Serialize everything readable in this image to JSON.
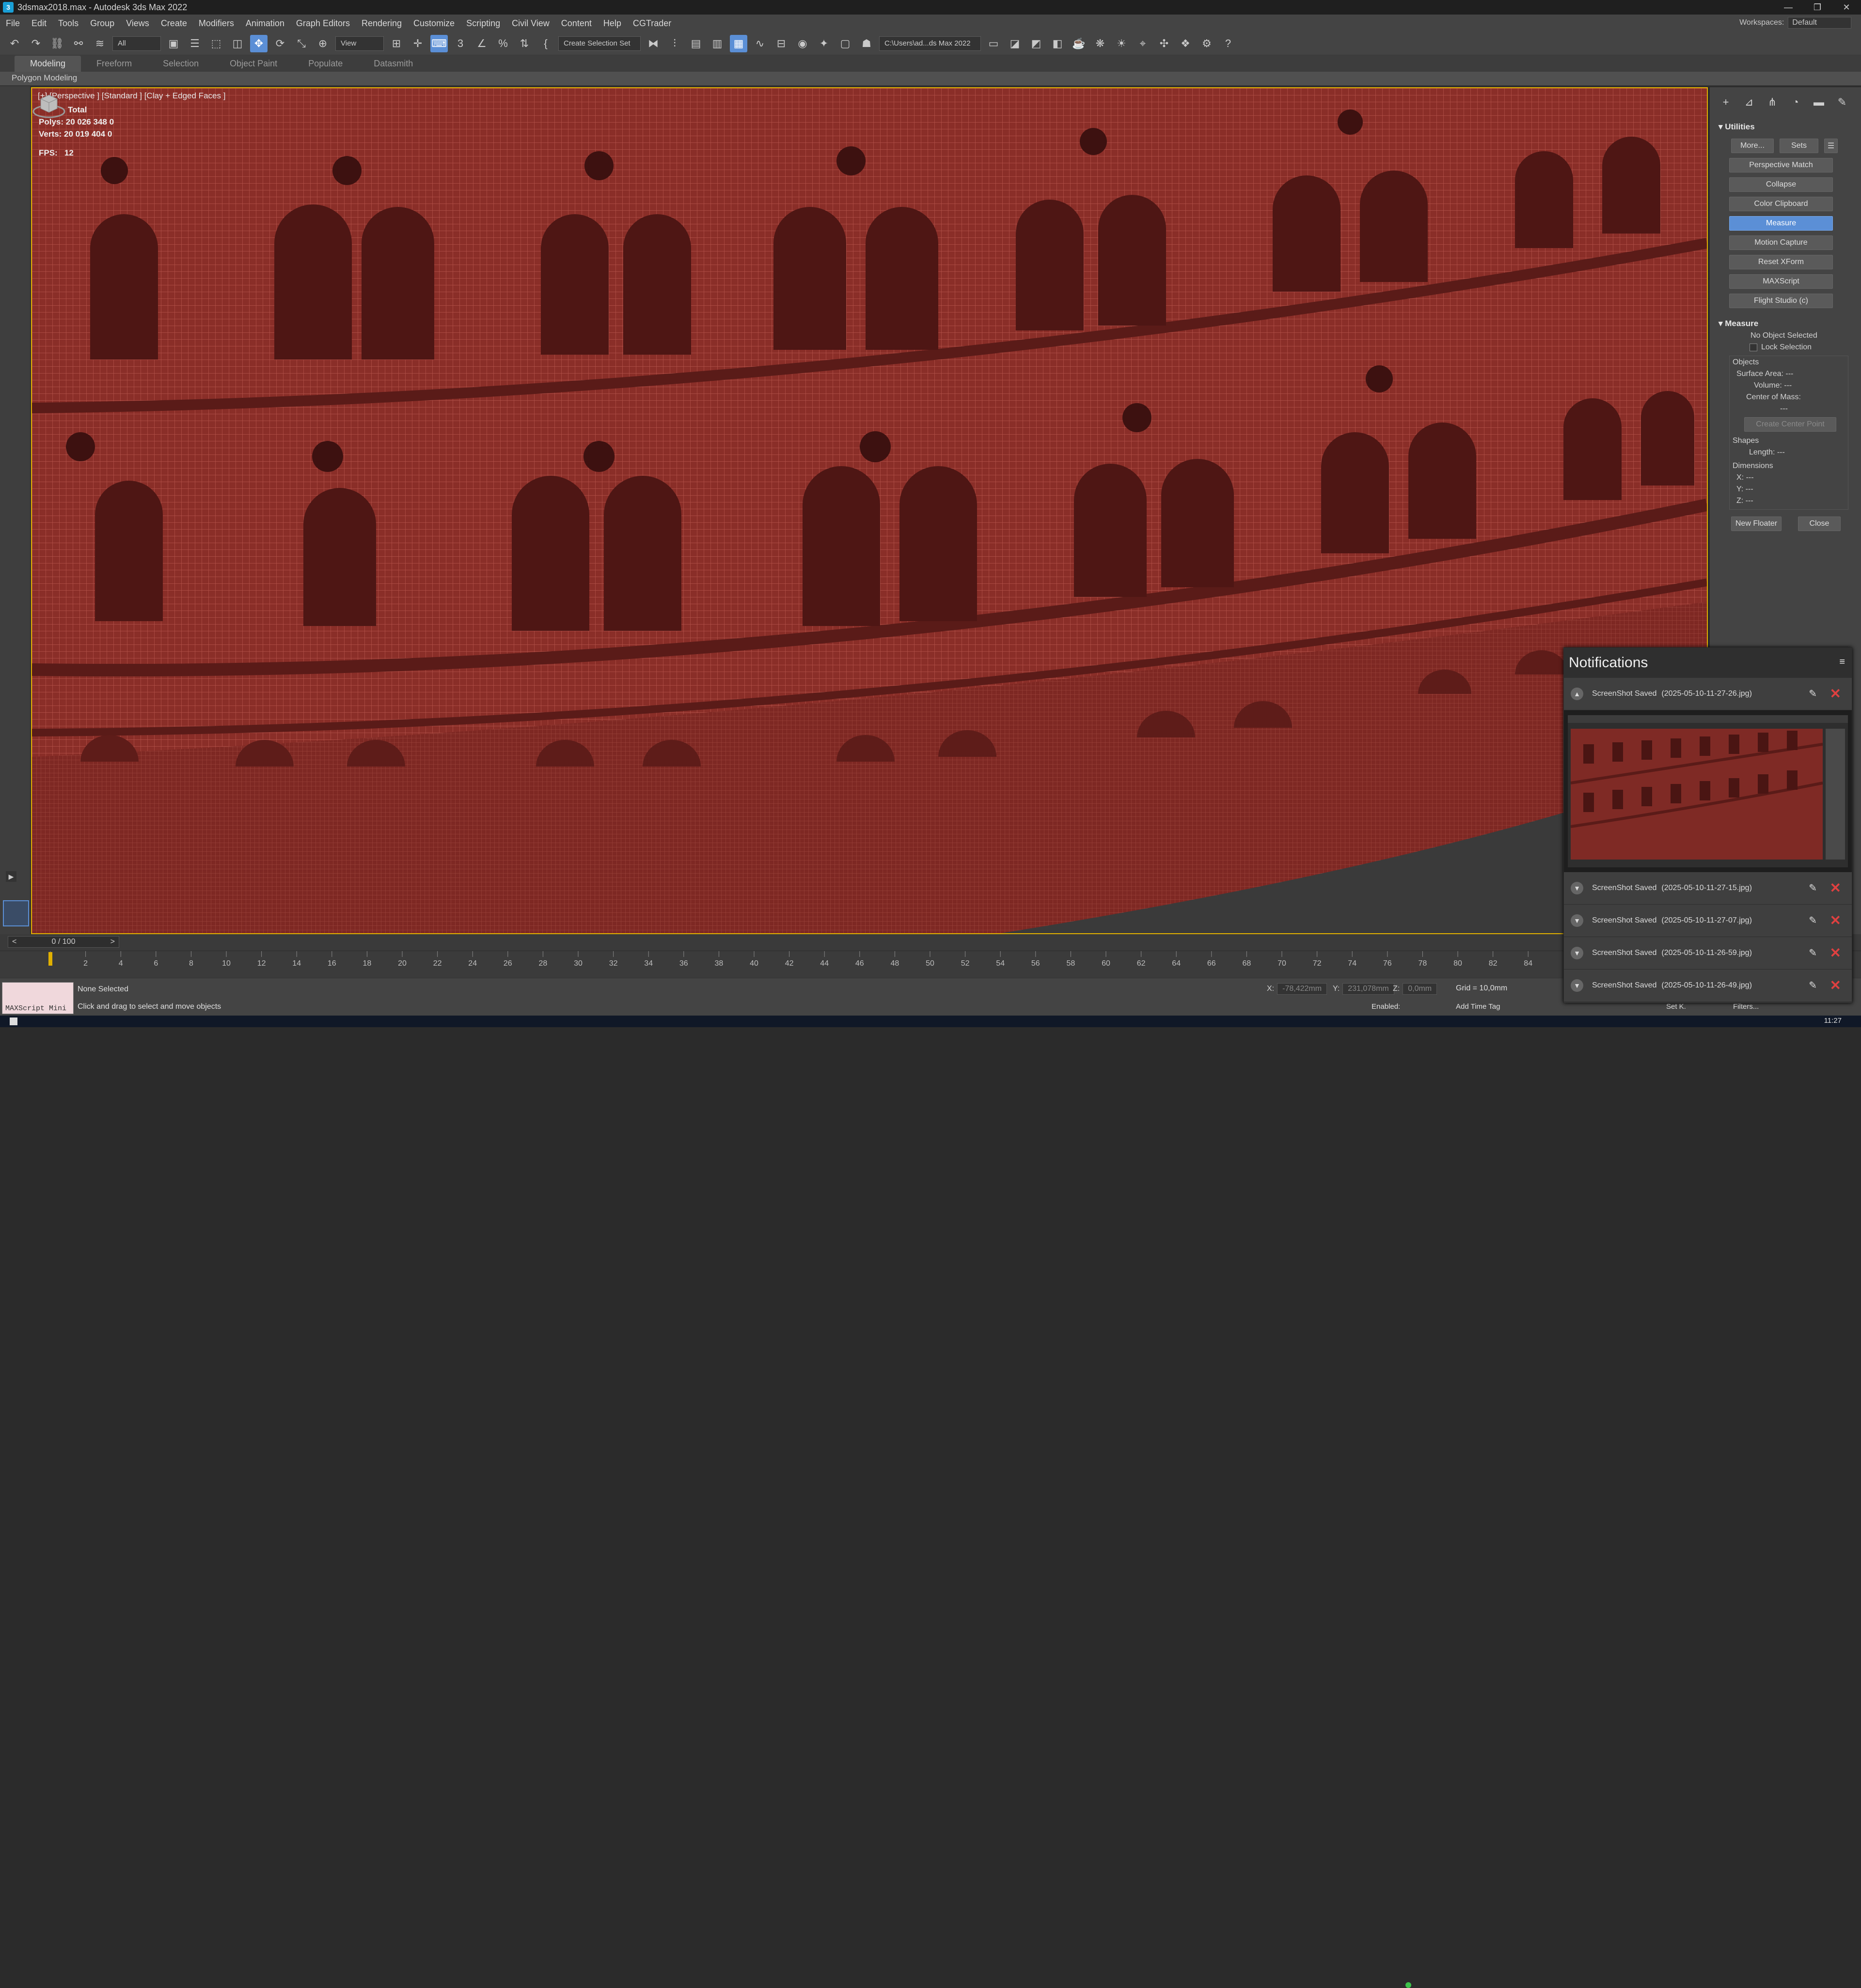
{
  "titlebar": {
    "title": "3dsmax2018.max - Autodesk 3ds Max 2022",
    "buttons": [
      "—",
      "❐",
      "✕"
    ]
  },
  "menubar": {
    "items": [
      "File",
      "Edit",
      "Tools",
      "Group",
      "Views",
      "Create",
      "Modifiers",
      "Animation",
      "Graph Editors",
      "Rendering",
      "Customize",
      "Scripting",
      "Civil View",
      "Content",
      "Help",
      "CGTrader"
    ],
    "workspaces_label": "Workspaces:",
    "workspaces_value": "Default"
  },
  "toolbar": {
    "filter_value": "All",
    "view_value": "View",
    "selection_set_value": "Create Selection Set",
    "path_value": "C:\\Users\\ad...ds Max 2022"
  },
  "ribbon": {
    "tabs": [
      "Modeling",
      "Freeform",
      "Selection",
      "Object Paint",
      "Populate",
      "Datasmith"
    ],
    "active_tab": "Modeling",
    "sub_label": "Polygon Modeling"
  },
  "viewport": {
    "label": "[+] [Perspective ] [Standard ] [Clay + Edged Faces ]",
    "stats_total": "Total",
    "polys_label": "Polys:",
    "polys_value": "20 026 348",
    "polys_sel": "0",
    "verts_label": "Verts:",
    "verts_value": "20 019 404",
    "verts_sel": "0",
    "fps_label": "FPS:",
    "fps_value": "12",
    "colors": {
      "clay": "#8a2e28",
      "wire": "#b4534a",
      "shadow": "#4e1614"
    }
  },
  "command_panel": {
    "tab_icons": [
      "plus-icon",
      "modify-icon",
      "hierarchy-icon",
      "motion-icon",
      "display-icon",
      "utilities-icon"
    ],
    "utilities_title": "Utilities",
    "more_label": "More...",
    "sets_label": "Sets",
    "utility_buttons": [
      "Perspective Match",
      "Collapse",
      "Color Clipboard",
      "Measure",
      "Motion Capture",
      "Reset XForm",
      "MAXScript",
      "Flight Studio (c)"
    ],
    "selected_utility": "Measure",
    "measure_title": "Measure",
    "no_object": "No Object Selected",
    "lock_selection": "Lock Selection",
    "objects_label": "Objects",
    "surface_area": "Surface Area:  ---",
    "volume": "Volume:  ---",
    "center_of_mass": "Center of Mass:",
    "center_value": "---",
    "create_center_point": "Create Center Point",
    "shapes_label": "Shapes",
    "length": "Length:  ---",
    "dimensions_label": "Dimensions",
    "dim_x": "X:  ---",
    "dim_y": "Y:  ---",
    "dim_z": "Z:  ---",
    "new_floater": "New Floater",
    "close": "Close"
  },
  "timeline": {
    "frame_display": "0 / 100",
    "prev": "<",
    "next": ">",
    "ticks": [
      "0",
      "2",
      "4",
      "6",
      "8",
      "10",
      "12",
      "14",
      "16",
      "18",
      "20",
      "22",
      "24",
      "26",
      "28",
      "30",
      "32",
      "34",
      "36",
      "38",
      "40",
      "42",
      "44",
      "46",
      "48",
      "50",
      "52",
      "54",
      "56",
      "58",
      "60",
      "62",
      "64",
      "66",
      "68",
      "70",
      "72",
      "74",
      "76",
      "78",
      "80",
      "82",
      "84"
    ]
  },
  "statusbar": {
    "maxscript_label": "MAXScript Mini",
    "selection_status": "None Selected",
    "prompt": "Click and drag to select and move objects",
    "x_label": "X:",
    "x_value": "-78,422mm",
    "y_label": "Y:",
    "y_value": "231,078mm",
    "z_label": "Z:",
    "z_value": "0,0mm",
    "grid": "Grid = 10,0mm",
    "enabled_label": "Enabled:",
    "add_time_tag": "Add Time Tag",
    "set_key": "Set K.",
    "filters": "Filters..."
  },
  "taskbar": {
    "clock": "11:27"
  },
  "notifications": {
    "title": "Notifications",
    "items": [
      {
        "label": "ScreenShot Saved",
        "file": "(2025-05-10-11-27-26.jpg)",
        "expanded": true
      },
      {
        "label": "ScreenShot Saved",
        "file": "(2025-05-10-11-27-15.jpg)",
        "expanded": false
      },
      {
        "label": "ScreenShot Saved",
        "file": "(2025-05-10-11-27-07.jpg)",
        "expanded": false
      },
      {
        "label": "ScreenShot Saved",
        "file": "(2025-05-10-11-26-59.jpg)",
        "expanded": false
      },
      {
        "label": "ScreenShot Saved",
        "file": "(2025-05-10-11-26-49.jpg)",
        "expanded": false
      }
    ]
  }
}
